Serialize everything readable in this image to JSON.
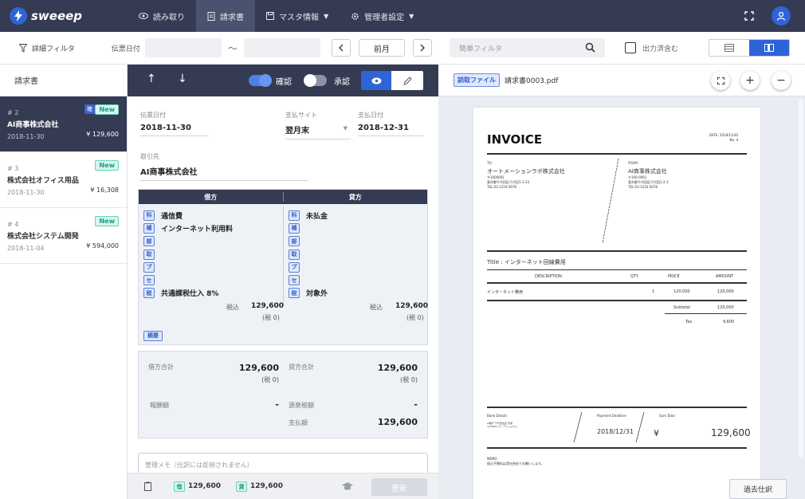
{
  "brand": {
    "logo_text": "sweeep",
    "accent": "#2f63d8",
    "nav_bg": "#343b52"
  },
  "nav": {
    "items": [
      {
        "label": "読み取り",
        "icon": "eye-icon"
      },
      {
        "label": "請求書",
        "icon": "document-icon",
        "active": true
      },
      {
        "label": "マスタ情報",
        "icon": "save-icon",
        "dropdown": true
      },
      {
        "label": "管理者設定",
        "icon": "gear-icon",
        "dropdown": true
      }
    ]
  },
  "filter": {
    "detail_label": "詳細フィルタ",
    "date_label": "伝票日付",
    "tilde": "〜",
    "prev_month_label": "前月",
    "search_placeholder": "簡単フィルタ",
    "output_done_label": "出力済含む"
  },
  "list": {
    "header": "請求書",
    "items": [
      {
        "num": "# 2",
        "name": "AI商事株式会社",
        "date": "2018-11-30",
        "amount": "¥ 129,600",
        "badge_new": "New",
        "badge_check": "確",
        "active": true
      },
      {
        "num": "# 3",
        "name": "株式会社オフィス用品",
        "date": "2018-11-30",
        "amount": "¥ 16,308",
        "badge_new": "New"
      },
      {
        "num": "# 4",
        "name": "株式会社システム開発",
        "date": "2018-11-04",
        "amount": "¥ 594,000",
        "badge_new": "New"
      }
    ]
  },
  "detail": {
    "confirm_label": "確認",
    "approve_label": "承認",
    "denpyo_label": "伝票日付",
    "denpyo_value": "2018-11-30",
    "site_label": "支払サイト",
    "site_value": "翌月末",
    "payday_label": "支払日付",
    "payday_value": "2018-12-31",
    "partner_label": "取引先",
    "partner_value": "AI商事株式会社",
    "debit_header": "借方",
    "credit_header": "貸方",
    "tags": [
      "科",
      "補",
      "部",
      "取",
      "プ",
      "セ",
      "税"
    ],
    "debit_rows": [
      "通信費",
      "インターネット利用料",
      "",
      "",
      "",
      "",
      "共通課税仕入 8%"
    ],
    "credit_rows": [
      "未払金",
      "",
      "",
      "",
      "",
      "",
      "対象外"
    ],
    "tax_in_label": "税込",
    "debit_amount": "129,600",
    "credit_amount": "129,600",
    "tax_zero": "(税 0)",
    "tekiyou_tag": "摘要",
    "debit_total_label": "借方合計",
    "debit_total": "129,600",
    "debit_total_tax": "(税 0)",
    "credit_total_label": "貸方合計",
    "credit_total": "129,600",
    "credit_total_tax": "(税 0)",
    "housyu_label": "報酬額",
    "housyu_value": "-",
    "gensen_label": "源泉税額",
    "gensen_value": "-",
    "payment_label": "支払額",
    "payment_value": "129,600",
    "memo_placeholder": "管理メモ（仕訳には反映されません）",
    "footer_debit_tag": "借",
    "footer_debit": "129,600",
    "footer_credit_tag": "貸",
    "footer_credit": "129,600",
    "update_label": "更新"
  },
  "preview": {
    "badge": "読取ファイル",
    "filename": "請求書0003.pdf",
    "past_label": "過去仕訳",
    "invoice": {
      "title": "INVOICE",
      "date_line": "DATE: 2018/11/30",
      "no_line": "No. 4",
      "to_label": "TO:",
      "to_name": "オートメーションラボ株式会社",
      "to_zip": "〒1000001",
      "to_addr1": "東京都千代田区千代田1-1-23",
      "to_addr2": "TEL:03-1234-5678",
      "from_label": "FROM:",
      "from_name": "AI商事株式会社",
      "from_zip": "〒100-0001",
      "from_addr1": "東京都千代田区千代田1-2-3",
      "from_addr2": "TEL:03-1234-5678",
      "subject": "Title : インターネット回線費用",
      "col_desc": "DESCRIPTION",
      "col_qty": "QTY",
      "col_price": "PRICE",
      "col_amount": "AMOUNT",
      "row_desc": "インターネット費用",
      "row_qty": "1",
      "row_price": "120,000",
      "row_amount": "120,000",
      "subtotal_label": "Subtotal",
      "subtotal": "120,000",
      "tax_label": "Tax",
      "tax": "9,600",
      "bank_label": "Bank Details",
      "bank_lines": "AI銀行 千代田支店 普通 1234567 エーアイショウジ",
      "deadline_label": "Payment Deadline",
      "deadline": "2018/12/31",
      "sumtotal_label": "Sum Total",
      "yen": "¥",
      "sumtotal": "129,600",
      "memo_label": "MEMO",
      "memo_text": "振込手数料は貴社負担でお願いします。"
    }
  }
}
